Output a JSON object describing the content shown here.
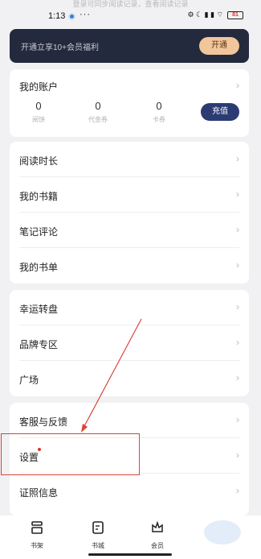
{
  "top_banner": "登录可同步阅读记录，查看阅读记录",
  "status": {
    "time": "1:13",
    "more": "···",
    "icons": "⚙ ☾ ▮ ▮ ⌔",
    "battery": "81"
  },
  "vip": {
    "text": "开通立享10+会员福利",
    "button": "开通"
  },
  "account": {
    "title": "我的账户",
    "stats": [
      {
        "value": "0",
        "label": "阅饼"
      },
      {
        "value": "0",
        "label": "代金券"
      },
      {
        "value": "0",
        "label": "卡券"
      }
    ],
    "recharge": "充值"
  },
  "group1": [
    "阅读时长",
    "我的书籍",
    "笔记评论",
    "我的书单"
  ],
  "group2": [
    "幸运转盘",
    "品牌专区",
    "广场"
  ],
  "group3": [
    "客服与反馈",
    "设置",
    "证照信息"
  ],
  "tabs": [
    "书架",
    "书城",
    "会员"
  ],
  "colors": {
    "accent_dark": "#2d3b73",
    "vip_bg": "#242a3d",
    "vip_btn": "#f1c69b",
    "annotation": "#d9443a"
  }
}
